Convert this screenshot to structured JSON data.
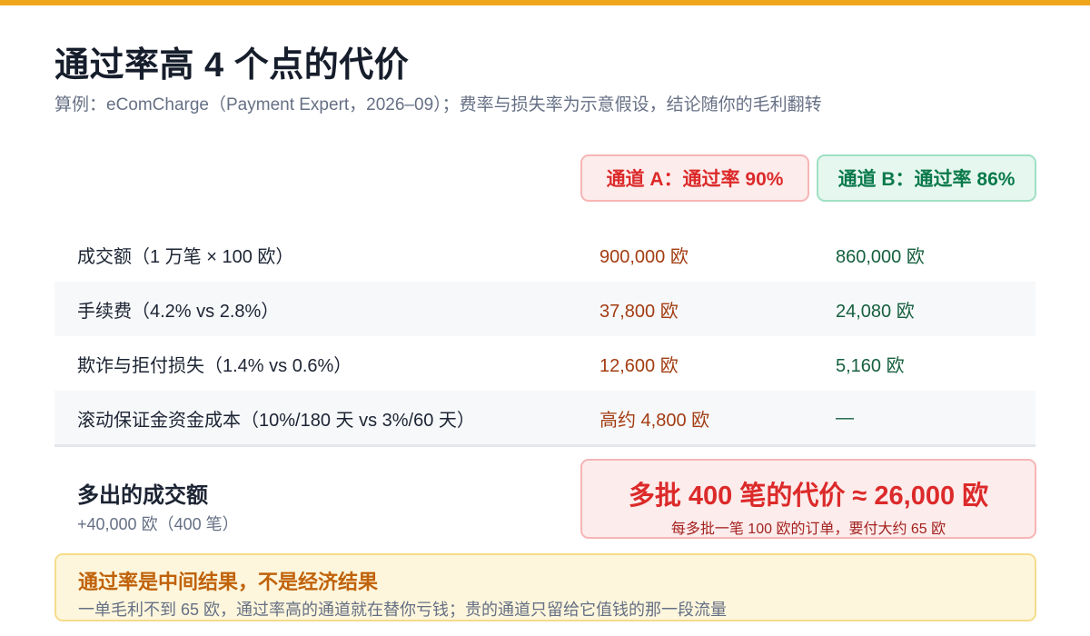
{
  "title": "通过率高 4 个点的代价",
  "subtitle": "算例：eComCharge（Payment Expert，2026–09）；费率与损失率为示意假设，结论随你的毛利翻转",
  "colors": {
    "accent": "#f0a61c",
    "channel_a": "#dc2a2a",
    "channel_b": "#0b7a4b"
  },
  "columns": {
    "a": "通道 A：通过率 90%",
    "b": "通道 B：通过率 86%"
  },
  "rows": [
    {
      "label": "成交额（1 万笔 × 100 欧）",
      "a": "900,000 欧",
      "b": "860,000 欧"
    },
    {
      "label": "手续费（4.2% vs 2.8%）",
      "a": "37,800 欧",
      "b": "24,080 欧"
    },
    {
      "label": "欺诈与拒付损失（1.4% vs 0.6%）",
      "a": "12,600 欧",
      "b": "5,160 欧"
    },
    {
      "label": "滚动保证金资金成本（10%/180 天 vs 3%/60 天）",
      "a": "高约 4,800 欧",
      "b": "—"
    }
  ],
  "extra": {
    "label": "多出的成交额",
    "sub": "+40,000 欧（400 笔）"
  },
  "cost": {
    "main": "多批 400 笔的代价 ≈ 26,000 欧",
    "sub": "每多批一笔 100 欧的订单，要付大约 65 欧"
  },
  "note": {
    "title": "通过率是中间结果，不是经济结果",
    "sub": "一单毛利不到 65 欧，通过率高的通道就在替你亏钱；贵的通道只留给它值钱的那一段流量"
  }
}
